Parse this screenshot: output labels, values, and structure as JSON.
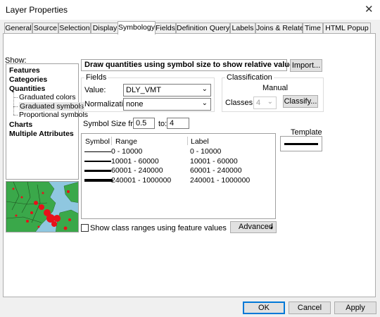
{
  "window": {
    "title": "Layer Properties",
    "close_glyph": "✕"
  },
  "tabs": [
    {
      "label": "General"
    },
    {
      "label": "Source"
    },
    {
      "label": "Selection"
    },
    {
      "label": "Display"
    },
    {
      "label": "Symbology",
      "active": true
    },
    {
      "label": "Fields"
    },
    {
      "label": "Definition Query"
    },
    {
      "label": "Labels"
    },
    {
      "label": "Joins & Relates"
    },
    {
      "label": "Time"
    },
    {
      "label": "HTML Popup"
    }
  ],
  "show": {
    "label": "Show:",
    "items": [
      {
        "label": "Features",
        "level": 0
      },
      {
        "label": "Categories",
        "level": 0
      },
      {
        "label": "Quantities",
        "level": 0
      },
      {
        "label": "Graduated colors",
        "level": 1
      },
      {
        "label": "Graduated symbols",
        "level": 1,
        "selected": true
      },
      {
        "label": "Proportional symbols",
        "level": 1
      },
      {
        "label": "Charts",
        "level": 0
      },
      {
        "label": "Multiple Attributes",
        "level": 0
      }
    ]
  },
  "description": "Draw quantities using symbol size to show relative values.",
  "import_button": "Import...",
  "fields": {
    "title": "Fields",
    "value_label": "Value:",
    "value": "DLY_VMT",
    "normalization_label": "Normalization:",
    "normalization": "none"
  },
  "classification": {
    "title": "Classification",
    "method": "Manual",
    "classes_label": "Classes:",
    "classes_value": "4",
    "classify_button": "Classify..."
  },
  "symbol_size": {
    "from_label": "Symbol Size from:",
    "from": "0.5",
    "to_label": "to:",
    "to": "4"
  },
  "symbol_table": {
    "headers": {
      "symbol": "Symbol",
      "range": "Range",
      "label": "Label"
    },
    "rows": [
      {
        "range": "0 - 10000",
        "label": "0 - 10000",
        "thickness": 1
      },
      {
        "range": "10001 - 60000",
        "label": "10001 - 60000",
        "thickness": 2
      },
      {
        "range": "60001 - 240000",
        "label": "60001 - 240000",
        "thickness": 3
      },
      {
        "range": "240001 - 1000000",
        "label": "240001 - 1000000",
        "thickness": 4
      }
    ]
  },
  "template_label": "Template",
  "show_class_ranges": "Show class ranges using feature values",
  "advanced_button": "Advanced",
  "footer": {
    "ok": "OK",
    "cancel": "Cancel",
    "apply": "Apply"
  },
  "colors": {
    "accent": "#0078d7",
    "map_water": "#8fc7e0",
    "map_land": "#3aa84a",
    "map_symbol": "#e8101a"
  }
}
